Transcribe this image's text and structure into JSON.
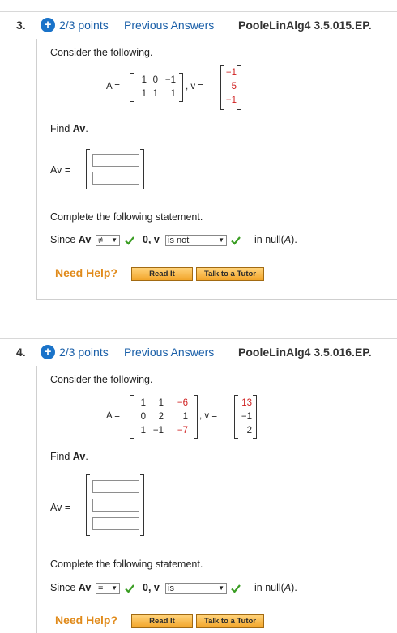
{
  "q3": {
    "number": "3.",
    "plus": "+",
    "points": "2/3 points",
    "prev": "Previous Answers",
    "code": "PooleLinAlg4 3.5.015.EP.",
    "consider": "Consider the following.",
    "A_label": "A =",
    "v_label": ", v =",
    "A": [
      [
        "1",
        "0",
        "−1"
      ],
      [
        "1",
        "1",
        "1"
      ]
    ],
    "v": [
      "−1",
      "5",
      "−1"
    ],
    "find_prefix": "Find ",
    "find_av": "Av",
    "find_suffix": ".",
    "av_label": "Av =",
    "complete": "Complete the following statement.",
    "since": "Since ",
    "since_av": "Av",
    "op": "≠",
    "zero_v": "0, v",
    "is_sel": "is not",
    "null_text": "in null(",
    "null_A": "A",
    "null_end": ").",
    "need_help": "Need Help?",
    "read_it": "Read It",
    "tutor": "Talk to a Tutor"
  },
  "q4": {
    "number": "4.",
    "plus": "+",
    "points": "2/3 points",
    "prev": "Previous Answers",
    "code": "PooleLinAlg4 3.5.016.EP.",
    "consider": "Consider the following.",
    "A_label": "A =",
    "v_label": ", v =",
    "A": [
      [
        "1",
        "1",
        "−6"
      ],
      [
        "0",
        "2",
        "1"
      ],
      [
        "1",
        "−1",
        "−7"
      ]
    ],
    "v": [
      "13",
      "−1",
      "2"
    ],
    "find_prefix": "Find ",
    "find_av": "Av",
    "find_suffix": ".",
    "av_label": "Av =",
    "complete": "Complete the following statement.",
    "since": "Since ",
    "since_av": "Av",
    "op": "=",
    "zero_v": "0, v",
    "is_sel": "is",
    "null_text": "in null(",
    "null_A": "A",
    "null_end": ").",
    "need_help": "Need Help?",
    "read_it": "Read It",
    "tutor": "Talk to a Tutor"
  },
  "colors": {
    "link": "#1a5fa8",
    "accent": "#1a73c9",
    "check": "#3a9d23",
    "help": "#e08a1a",
    "red": "#d02020"
  }
}
